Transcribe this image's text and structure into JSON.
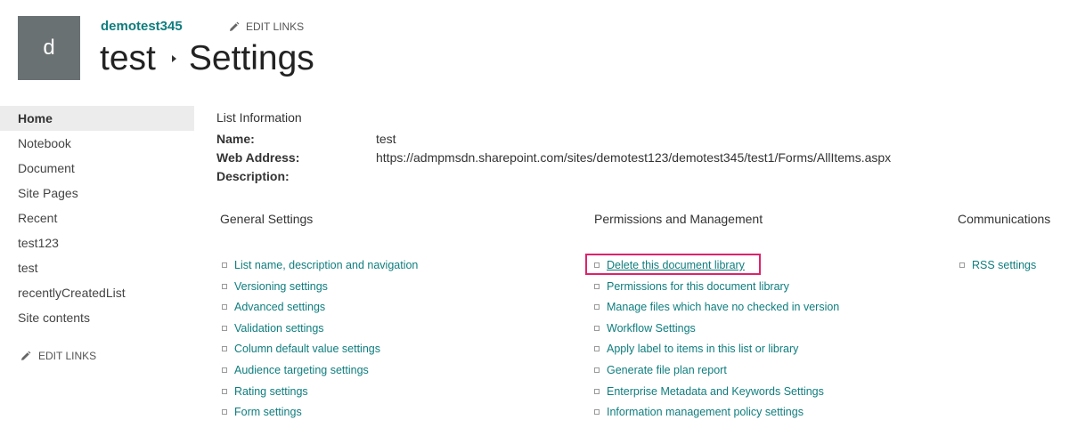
{
  "header": {
    "logo_letter": "d",
    "site_name": "demotest345",
    "edit_links_label": "EDIT LINKS",
    "breadcrumb": [
      "test",
      "Settings"
    ]
  },
  "left_nav": {
    "items": [
      {
        "label": "Home",
        "selected": true
      },
      {
        "label": "Notebook"
      },
      {
        "label": "Document"
      },
      {
        "label": "Site Pages"
      },
      {
        "label": "Recent"
      },
      {
        "label": "test123"
      },
      {
        "label": "test"
      },
      {
        "label": "recentlyCreatedList"
      },
      {
        "label": "Site contents"
      }
    ],
    "edit_links_label": "EDIT LINKS"
  },
  "list_information": {
    "heading": "List Information",
    "name_label": "Name:",
    "name_value": "test",
    "web_address_label": "Web Address:",
    "web_address_value": "https://admpmsdn.sharepoint.com/sites/demotest123/demotest345/test1/Forms/AllItems.aspx",
    "description_label": "Description:"
  },
  "general_settings": {
    "heading": "General Settings",
    "links": [
      "List name, description and navigation",
      "Versioning settings",
      "Advanced settings",
      "Validation settings",
      "Column default value settings",
      "Audience targeting settings",
      "Rating settings",
      "Form settings"
    ]
  },
  "permissions_management": {
    "heading": "Permissions and Management",
    "links": [
      "Delete this document library",
      "Permissions for this document library",
      "Manage files which have no checked in version",
      "Workflow Settings",
      "Apply label to items in this list or library",
      "Generate file plan report",
      "Enterprise Metadata and Keywords Settings",
      "Information management policy settings"
    ]
  },
  "communications": {
    "heading": "Communications",
    "links": [
      "RSS settings"
    ]
  },
  "colors": {
    "link": "#0f7d7e",
    "highlight": "#e0216c",
    "logo_bg": "#6a7173",
    "nav_selected_bg": "#ececec"
  }
}
